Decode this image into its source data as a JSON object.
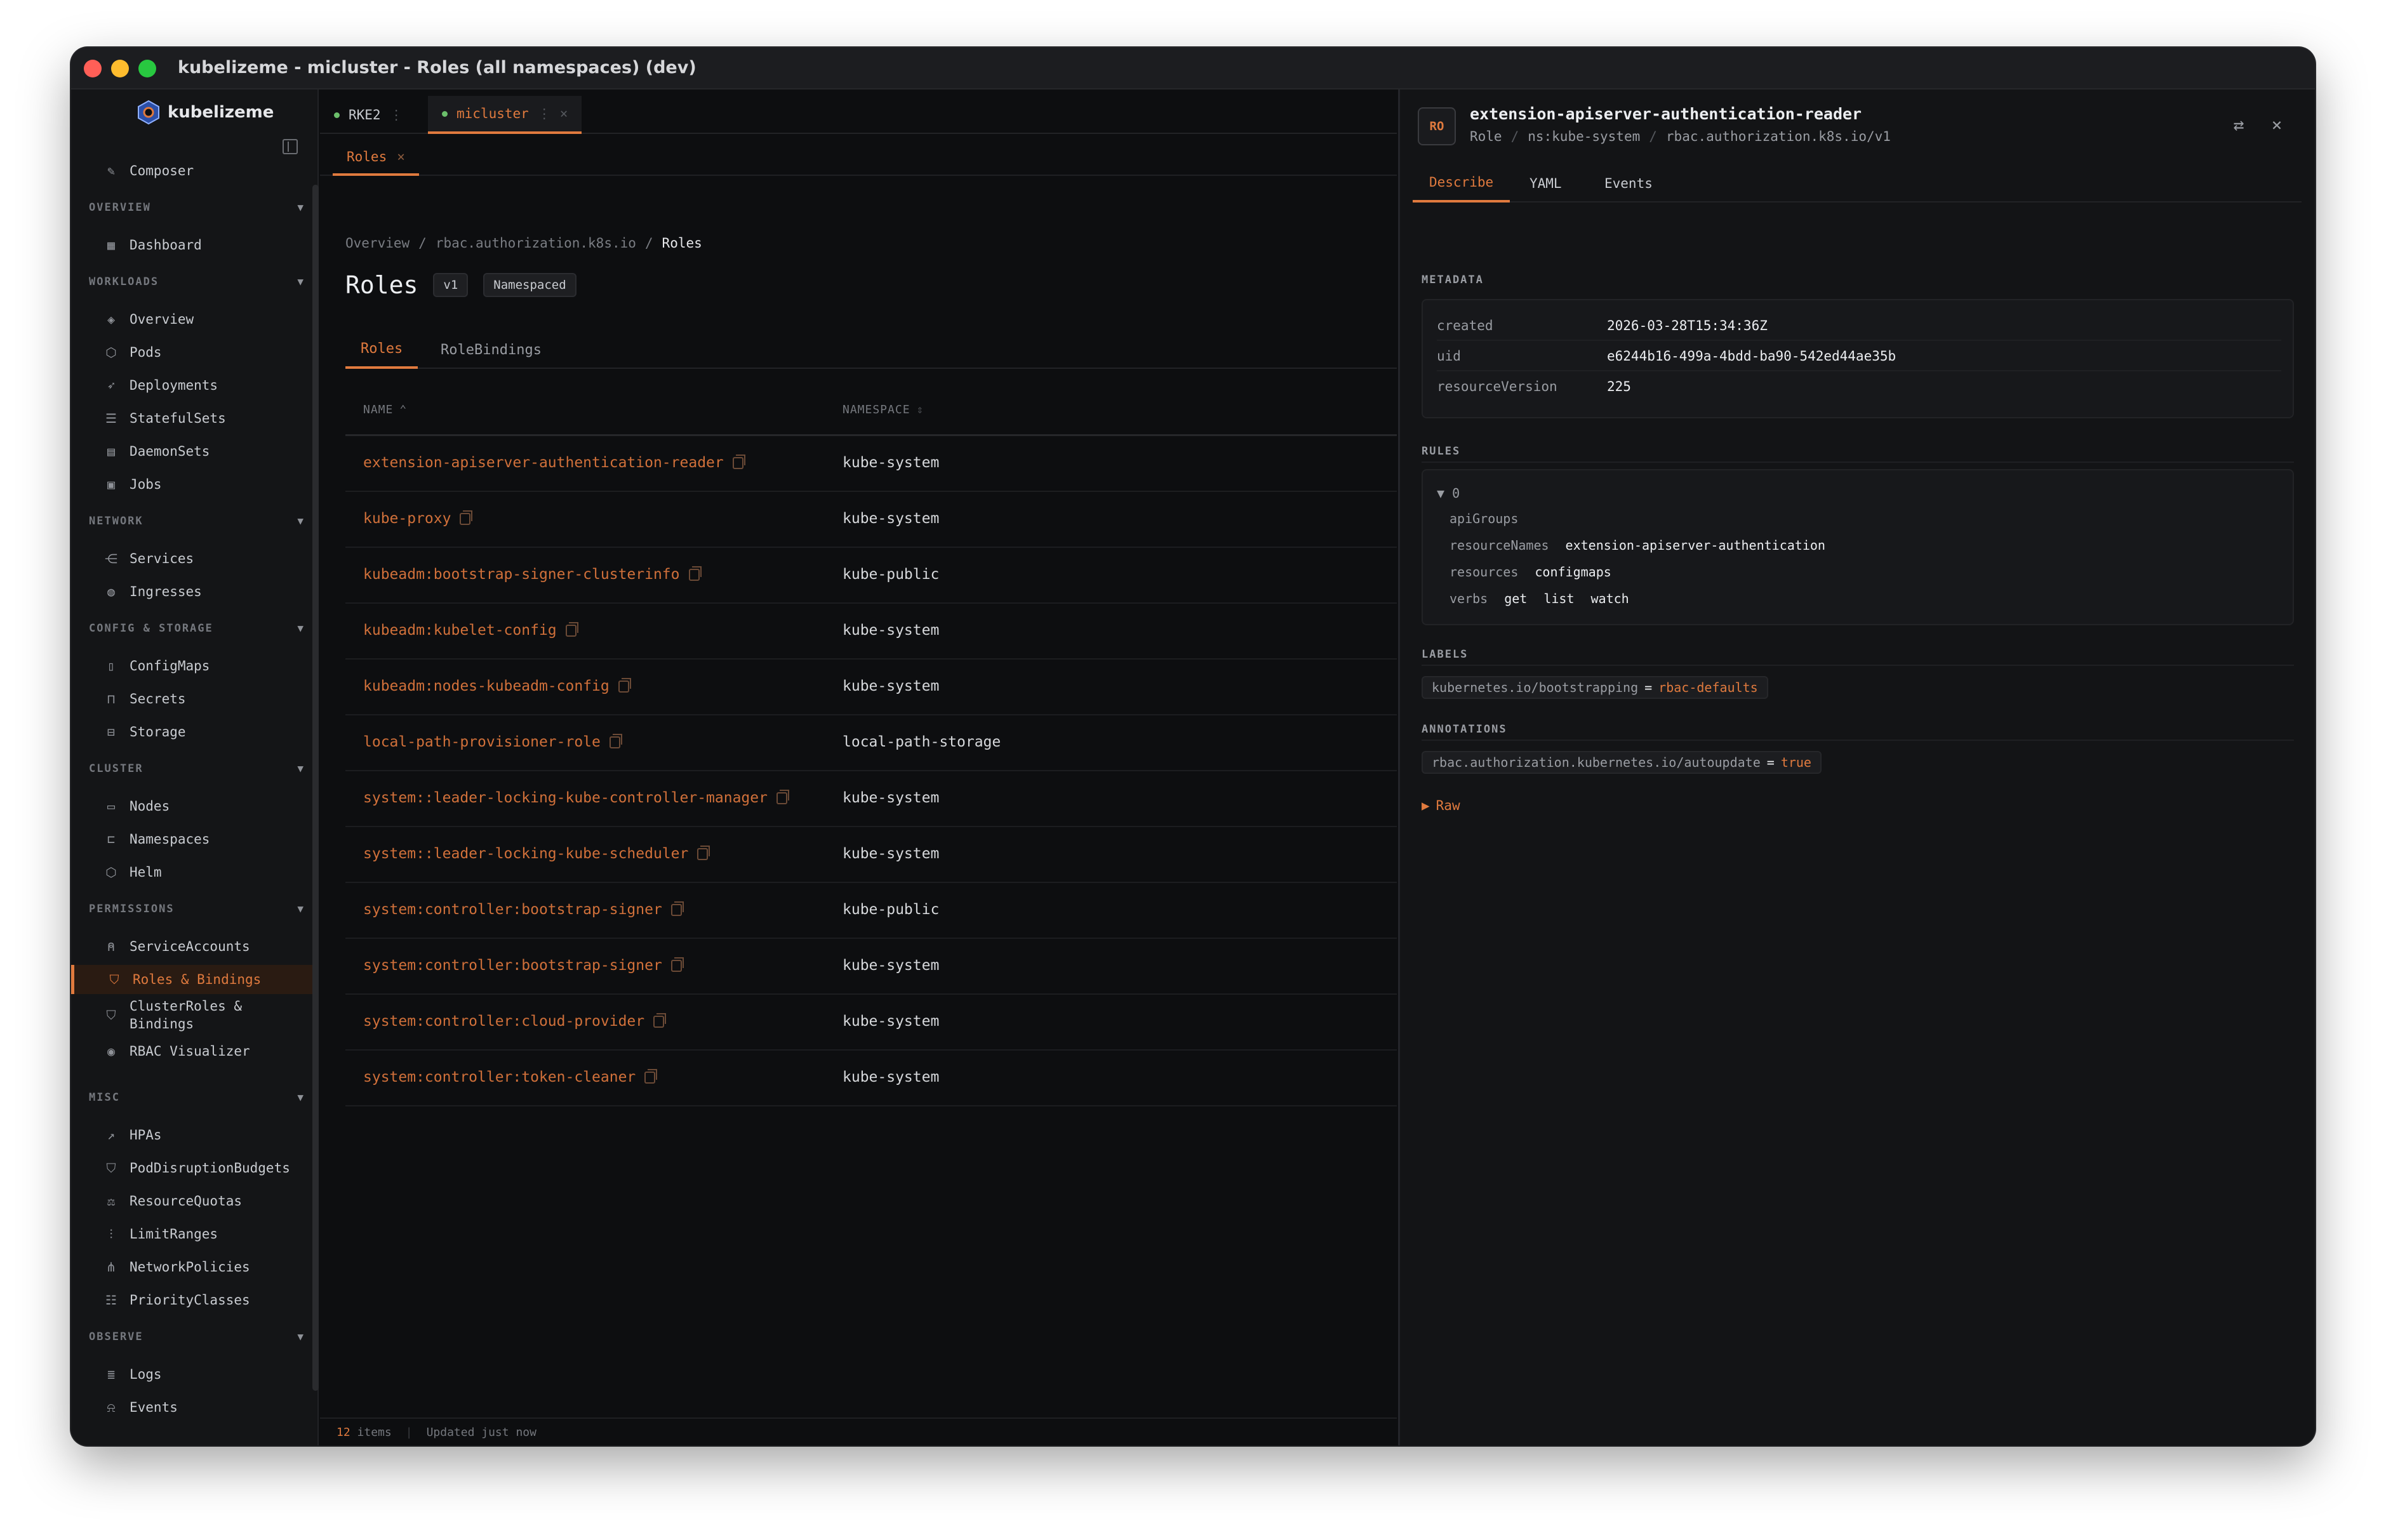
{
  "window": {
    "title": "kubelizeme - micluster - Roles (all namespaces) (dev)"
  },
  "app": {
    "name": "kubelizeme"
  },
  "sidebar": {
    "composer": "Composer",
    "sections": {
      "overview": "OVERVIEW",
      "workloads": "WORKLOADS",
      "network": "NETWORK",
      "config": "CONFIG & STORAGE",
      "cluster": "CLUSTER",
      "permissions": "PERMISSIONS",
      "misc": "MISC",
      "observe": "OBSERVE"
    },
    "items": {
      "dashboard": "Dashboard",
      "overview": "Overview",
      "pods": "Pods",
      "deployments": "Deployments",
      "statefulsets": "StatefulSets",
      "daemonsets": "DaemonSets",
      "jobs": "Jobs",
      "services": "Services",
      "ingresses": "Ingresses",
      "configmaps": "ConfigMaps",
      "secrets": "Secrets",
      "storage": "Storage",
      "nodes": "Nodes",
      "namespaces": "Namespaces",
      "helm": "Helm",
      "serviceaccounts": "ServiceAccounts",
      "roles_bindings": "Roles & Bindings",
      "clusterroles_1": "ClusterRoles &",
      "clusterroles_2": "Bindings",
      "rbac_visualizer": "RBAC Visualizer",
      "hpas": "HPAs",
      "pdbs": "PodDisruptionBudgets",
      "resourcequotas": "ResourceQuotas",
      "limitranges": "LimitRanges",
      "networkpolicies": "NetworkPolicies",
      "priorityclasses": "PriorityClasses",
      "logs": "Logs",
      "events": "Events"
    }
  },
  "cluster_tabs": [
    {
      "label": "RKE2",
      "sep": "⋮"
    },
    {
      "label": "micluster",
      "sep": "⋮",
      "close": "×"
    }
  ],
  "view_tab": {
    "label": "Roles",
    "close": "×"
  },
  "breadcrumb": {
    "a": "Overview",
    "b": "rbac.authorization.k8s.io",
    "c": "Roles",
    "sep": "/"
  },
  "page": {
    "title": "Roles",
    "version": "v1",
    "scope": "Namespaced"
  },
  "inner_tabs": {
    "roles": "Roles",
    "rolebindings": "RoleBindings"
  },
  "table": {
    "headers": {
      "name": "NAME",
      "name_sort": "⌃",
      "namespace": "NAMESPACE",
      "namespace_sort": "⇕"
    },
    "rows": [
      {
        "name": "extension-apiserver-authentication-reader",
        "namespace": "kube-system"
      },
      {
        "name": "kube-proxy",
        "namespace": "kube-system"
      },
      {
        "name": "kubeadm:bootstrap-signer-clusterinfo",
        "namespace": "kube-public"
      },
      {
        "name": "kubeadm:kubelet-config",
        "namespace": "kube-system"
      },
      {
        "name": "kubeadm:nodes-kubeadm-config",
        "namespace": "kube-system"
      },
      {
        "name": "local-path-provisioner-role",
        "namespace": "local-path-storage"
      },
      {
        "name": "system::leader-locking-kube-controller-manager",
        "namespace": "kube-system"
      },
      {
        "name": "system::leader-locking-kube-scheduler",
        "namespace": "kube-system"
      },
      {
        "name": "system:controller:bootstrap-signer",
        "namespace": "kube-public"
      },
      {
        "name": "system:controller:bootstrap-signer",
        "namespace": "kube-system"
      },
      {
        "name": "system:controller:cloud-provider",
        "namespace": "kube-system"
      },
      {
        "name": "system:controller:token-cleaner",
        "namespace": "kube-system"
      }
    ]
  },
  "footer": {
    "count": "12",
    "items_label": "items",
    "sep": "|",
    "updated": "Updated just now"
  },
  "panel": {
    "avatar": "RO",
    "title": "extension-apiserver-authentication-reader",
    "kind": "Role",
    "ns": "ns:kube-system",
    "api": "rbac.authorization.k8s.io/v1",
    "sep": "/",
    "tabs": {
      "describe": "Describe",
      "yaml": "YAML",
      "events": "Events"
    },
    "sections": {
      "metadata": "METADATA",
      "rules": "RULES",
      "labels": "LABELS",
      "annotations": "ANNOTATIONS"
    },
    "metadata": {
      "created_k": "created",
      "created_v": "2026-03-28T15:34:36Z",
      "uid_k": "uid",
      "uid_v": "e6244b16-499a-4bdd-ba90-542ed44ae35b",
      "rv_k": "resourceVersion",
      "rv_v": "225"
    },
    "rules": {
      "index": "▼ 0",
      "apigroups_k": "apiGroups",
      "resourcenames_k": "resourceNames",
      "resourcenames_v": "extension-apiserver-authentication",
      "resources_k": "resources",
      "resources_v": "configmaps",
      "verbs_k": "verbs",
      "verbs": [
        "get",
        "list",
        "watch"
      ]
    },
    "label": {
      "key": "kubernetes.io/bootstrapping",
      "eq": "=",
      "value": "rbac-defaults"
    },
    "annotation": {
      "key": "rbac.authorization.kubernetes.io/autoupdate",
      "eq": "=",
      "value": "true"
    },
    "raw": "Raw",
    "raw_caret": "▶"
  },
  "colors": {
    "accent": "#e07a3e",
    "bg": "#0d0e10",
    "panel": "#131416"
  }
}
